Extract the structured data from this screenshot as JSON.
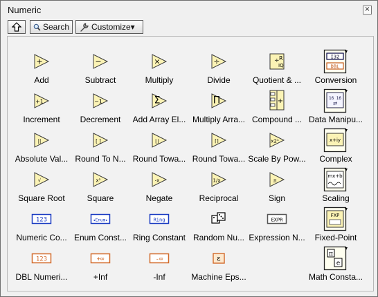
{
  "window": {
    "title": "Numeric",
    "close_symbol": "×"
  },
  "toolbar": {
    "search_label": "Search",
    "customize_label": "Customize▾"
  },
  "palette": {
    "rows": [
      [
        {
          "label": "Add",
          "icon": "add-icon",
          "glyph": "+"
        },
        {
          "label": "Subtract",
          "icon": "subtract-icon",
          "glyph": "−"
        },
        {
          "label": "Multiply",
          "icon": "multiply-icon",
          "glyph": "×"
        },
        {
          "label": "Divide",
          "icon": "divide-icon",
          "glyph": "÷"
        },
        {
          "label": "Quotient & ...",
          "icon": "quotient-remainder-icon",
          "glyph": "R"
        },
        {
          "label": "Conversion",
          "icon": "conversion-icon",
          "glyph": "I32"
        }
      ],
      [
        {
          "label": "Increment",
          "icon": "increment-icon",
          "glyph": "+1"
        },
        {
          "label": "Decrement",
          "icon": "decrement-icon",
          "glyph": "−1"
        },
        {
          "label": "Add Array El...",
          "icon": "add-array-elements-icon",
          "glyph": "Σ"
        },
        {
          "label": "Multiply Arra...",
          "icon": "multiply-array-elements-icon",
          "glyph": "Π"
        },
        {
          "label": "Compound ...",
          "icon": "compound-arithmetic-icon",
          "glyph": "+"
        },
        {
          "label": "Data Manipu...",
          "icon": "data-manipulation-icon",
          "glyph": "16"
        }
      ],
      [
        {
          "label": "Absolute Val...",
          "icon": "absolute-value-icon",
          "glyph": "||"
        },
        {
          "label": "Round To N...",
          "icon": "round-to-nearest-icon",
          "glyph": "[ ]"
        },
        {
          "label": "Round Towa...",
          "icon": "round-toward-neg-inf-icon",
          "glyph": "⌊⌋"
        },
        {
          "label": "Round Towa...",
          "icon": "round-toward-pos-inf-icon",
          "glyph": "⌈⌉"
        },
        {
          "label": "Scale By Pow...",
          "icon": "scale-by-power-of-2-icon",
          "glyph": "x2ⁿ"
        },
        {
          "label": "Complex",
          "icon": "complex-icon",
          "glyph": "x+iy"
        }
      ],
      [
        {
          "label": "Square Root",
          "icon": "square-root-icon",
          "glyph": "√"
        },
        {
          "label": "Square",
          "icon": "square-icon",
          "glyph": "x²"
        },
        {
          "label": "Negate",
          "icon": "negate-icon",
          "glyph": "-x"
        },
        {
          "label": "Reciprocal",
          "icon": "reciprocal-icon",
          "glyph": "1/x"
        },
        {
          "label": "Sign",
          "icon": "sign-icon",
          "glyph": "±"
        },
        {
          "label": "Scaling",
          "icon": "scaling-icon",
          "glyph": "mx+b"
        }
      ],
      [
        {
          "label": "Numeric Co...",
          "icon": "numeric-constant-icon",
          "glyph": "123"
        },
        {
          "label": "Enum Const...",
          "icon": "enum-constant-icon",
          "glyph": "Enum"
        },
        {
          "label": "Ring Constant",
          "icon": "ring-constant-icon",
          "glyph": "Ring"
        },
        {
          "label": "Random Nu...",
          "icon": "random-number-icon",
          "glyph": "dice"
        },
        {
          "label": "Expression N...",
          "icon": "expression-node-icon",
          "glyph": "EXPR"
        },
        {
          "label": "Fixed-Point",
          "icon": "fixed-point-icon",
          "glyph": "FXP"
        }
      ],
      [
        {
          "label": "DBL Numeri...",
          "icon": "dbl-numeric-constant-icon",
          "glyph": "123"
        },
        {
          "label": "+Inf",
          "icon": "pos-infinity-icon",
          "glyph": "+∞"
        },
        {
          "label": "-Inf",
          "icon": "neg-infinity-icon",
          "glyph": "-∞"
        },
        {
          "label": "Machine Eps...",
          "icon": "machine-epsilon-icon",
          "glyph": "ε"
        },
        {
          "label": "",
          "icon": "",
          "glyph": ""
        },
        {
          "label": "Math Consta...",
          "icon": "math-constants-icon",
          "glyph": "π"
        }
      ]
    ]
  }
}
